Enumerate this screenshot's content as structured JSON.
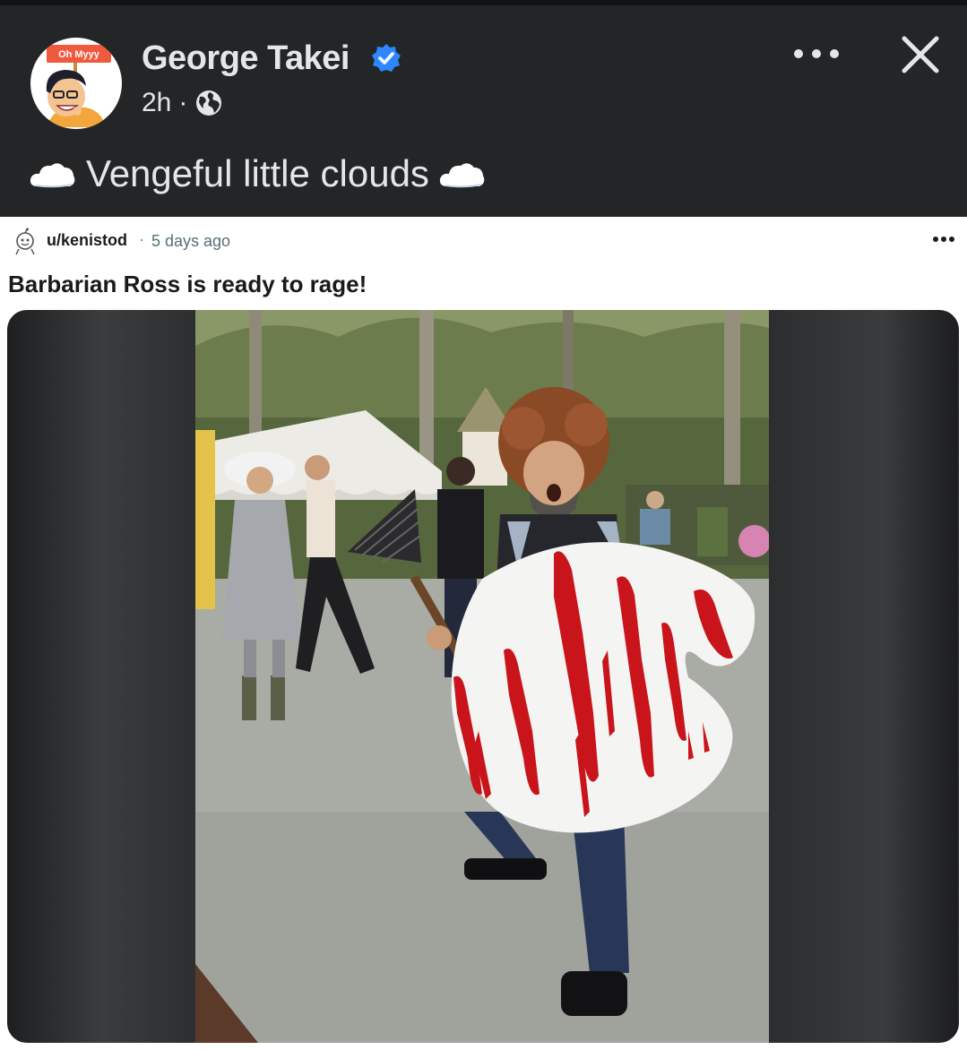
{
  "post": {
    "author": "George Takei",
    "time": "2h",
    "separator": "·",
    "avatar_sign_text": "Oh Myyy",
    "caption": "Vengeful little clouds"
  },
  "embedded": {
    "username": "u/kenistod",
    "separator": "·",
    "time": "5 days ago",
    "title": "Barbarian Ross is ready to rage!"
  },
  "icons": {
    "verified": "verified-badge-icon",
    "audience": "globe-icon",
    "more": "more-options-icon",
    "close": "close-icon",
    "emoji": "cloud-emoji-icon"
  },
  "colors": {
    "background": "#242526",
    "text": "#e4e6eb",
    "verified": "#2d88ff",
    "blood": "#c8141a"
  }
}
